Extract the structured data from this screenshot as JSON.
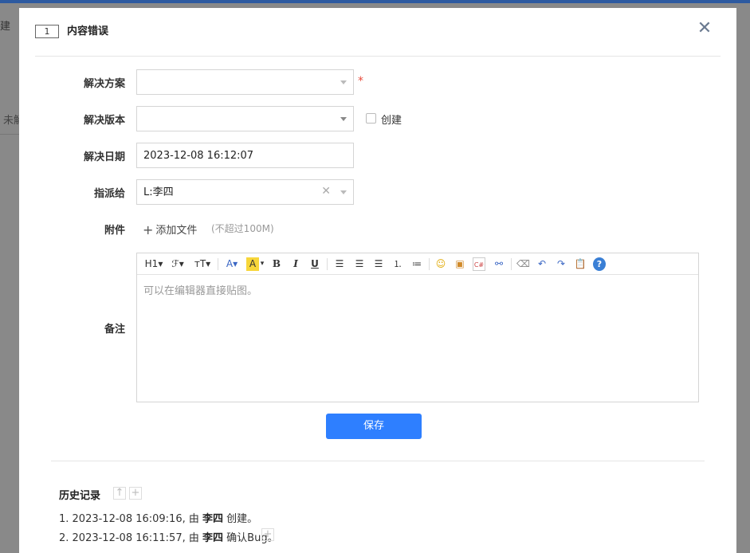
{
  "background": {
    "text1": "建",
    "text2": "未解"
  },
  "modal": {
    "id": "1",
    "title": "内容错误",
    "close_icon": "close-icon"
  },
  "form": {
    "resolution_label": "解决方案",
    "resolution_value": "",
    "required_mark": "*",
    "build_label": "解决版本",
    "build_value": "",
    "create_label": "创建",
    "date_label": "解决日期",
    "date_value": "2023-12-08 16:12:07",
    "assign_label": "指派给",
    "assign_value": "L:李四",
    "attach_label": "附件",
    "attach_button": "添加文件",
    "attach_hint": "(不超过100M)",
    "comment_label": "备注",
    "editor_placeholder": "可以在编辑器直接贴图。",
    "save_button": "保存"
  },
  "toolbar": {
    "h1": "H1▾",
    "font": "ℱ▾",
    "size": "ᴛT▾",
    "color": "A▾",
    "bg": "A",
    "bold": "B",
    "italic": "I",
    "underline": "U"
  },
  "history": {
    "title": "历史记录",
    "items": [
      {
        "prefix": "1. 2023-12-08 16:09:16, 由 ",
        "user": "李四",
        "suffix": " 创建。"
      },
      {
        "prefix": "2. 2023-12-08 16:11:57, 由 ",
        "user": "李四",
        "suffix": " 确认Bug。"
      }
    ]
  },
  "colors": {
    "primary": "#2e7fff",
    "required": "#e84c3d"
  }
}
